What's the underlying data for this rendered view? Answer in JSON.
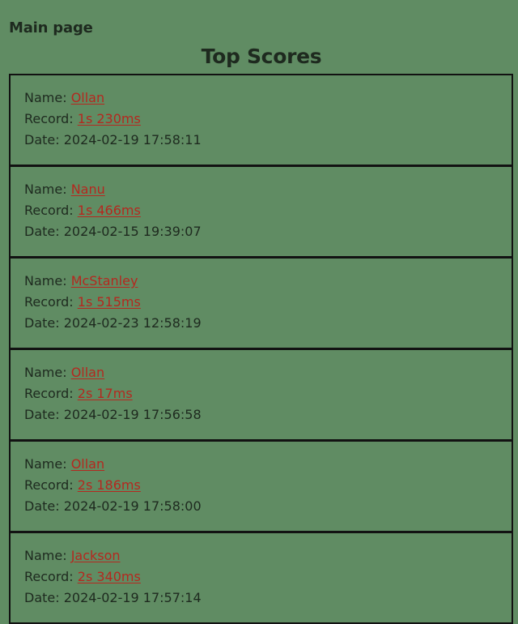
{
  "nav": {
    "main_page": "Main page"
  },
  "page": {
    "title": "Top Scores"
  },
  "labels": {
    "name": "Name:",
    "record": "Record:",
    "date": "Date:"
  },
  "colors": {
    "background": "#608c63",
    "text": "#1e2a1f",
    "link": "#b5281f",
    "border": "#121212"
  },
  "scores": [
    {
      "name": "Ollan",
      "record": "1s 230ms",
      "date": "2024-02-19 17:58:11"
    },
    {
      "name": "Nanu",
      "record": "1s 466ms",
      "date": "2024-02-15 19:39:07"
    },
    {
      "name": "McStanley",
      "record": "1s 515ms",
      "date": "2024-02-23 12:58:19"
    },
    {
      "name": "Ollan",
      "record": "2s 17ms",
      "date": "2024-02-19 17:56:58"
    },
    {
      "name": "Ollan",
      "record": "2s 186ms",
      "date": "2024-02-19 17:58:00"
    },
    {
      "name": "Jackson",
      "record": "2s 340ms",
      "date": "2024-02-19 17:57:14"
    }
  ]
}
